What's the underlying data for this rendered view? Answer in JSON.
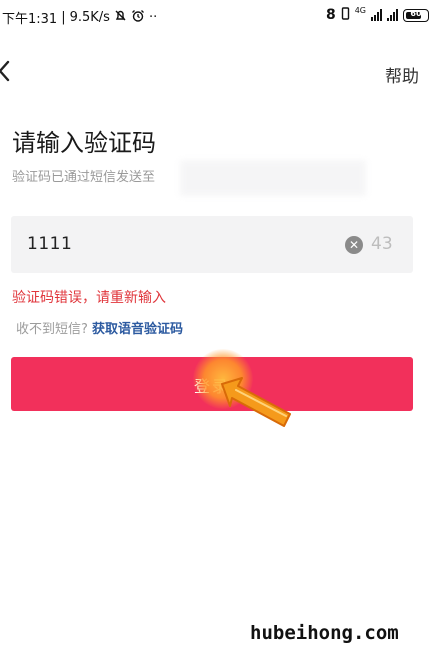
{
  "status_bar": {
    "time": "下午1:31",
    "speed": "9.5K/s",
    "right_number": "8",
    "network_label": "4G",
    "battery": "60"
  },
  "nav": {
    "help_label": "帮助"
  },
  "main": {
    "title": "请输入验证码",
    "subtitle": "验证码已通过短信发送至",
    "code_value": "1111",
    "countdown": "43",
    "error_message": "验证码错误，请重新输入",
    "voice_prefix": "收不到短信?",
    "voice_link": "获取语音验证码",
    "login_label": "登录"
  },
  "watermark": "hubeihong.com",
  "colors": {
    "accent": "#f2305b",
    "error": "#e0363c",
    "link": "#2c5aa0"
  },
  "icons": [
    "bell-off-icon",
    "alarm-icon",
    "signal-icon",
    "battery-icon",
    "back-arrow-icon",
    "clear-icon",
    "pointer-hand-icon"
  ]
}
